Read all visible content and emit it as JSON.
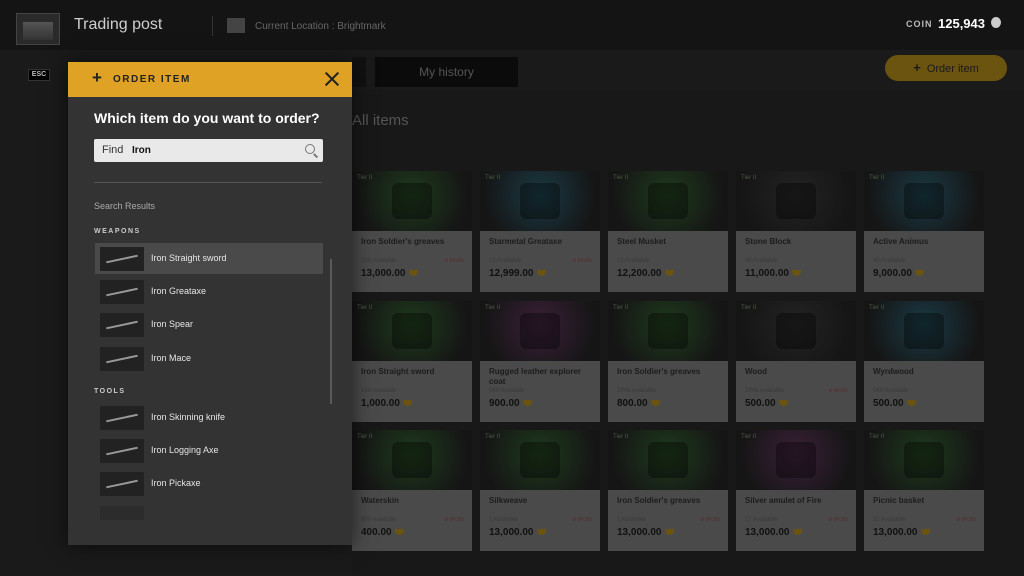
{
  "header": {
    "title": "Trading post",
    "location": "Current Location : Brightmark",
    "coin_label": "COIN",
    "coin_value": "125,943"
  },
  "esc_label": "ESC",
  "page": {
    "tab_history": "My history",
    "order_button": "Order item",
    "order_button_plus": "+",
    "section_title": "All items"
  },
  "cards": [
    {
      "tier": "Tier II",
      "name": "Iron Soldier's greaves",
      "available": "208 Available",
      "sale": "⊘ 84.5%",
      "price": "13,000.00",
      "color": "#1e3a1c"
    },
    {
      "tier": "Tier II",
      "name": "Starmetal Greataxe",
      "available": "12 Available",
      "sale": "⊘ 84.5%",
      "price": "12,999.00",
      "color": "#1a3a45"
    },
    {
      "tier": "Tier II",
      "name": "Steel Musket",
      "available": "12 Available",
      "sale": "",
      "price": "12,200.00",
      "color": "#1e3a1c"
    },
    {
      "tier": "Tier II",
      "name": "Stone Block",
      "available": "40 Available",
      "sale": "",
      "price": "11,000.00",
      "color": "#232323"
    },
    {
      "tier": "Tier II",
      "name": "Active Animus",
      "available": "45 Available",
      "sale": "",
      "price": "9,000.00",
      "color": "#1a3a45"
    },
    {
      "tier": "Tier II",
      "name": "Iron Straight sword",
      "available": "149 Available",
      "sale": "",
      "price": "1,000.00",
      "color": "#1e3a1c"
    },
    {
      "tier": "Tier II",
      "name": "Rugged leather explorer coat",
      "available": "549 Available",
      "sale": "",
      "price": "900.00",
      "color": "#3a2038"
    },
    {
      "tier": "Tier II",
      "name": "Iron Soldier's greaves",
      "available": "2049 Available",
      "sale": "",
      "price": "800.00",
      "color": "#1e3a1c"
    },
    {
      "tier": "Tier II",
      "name": "Wood",
      "available": "2049 Available",
      "sale": "⊘ 84.5%",
      "price": "500.00",
      "color": "#232323"
    },
    {
      "tier": "Tier II",
      "name": "Wyrdwood",
      "available": "549 Available",
      "sale": "",
      "price": "500.00",
      "color": "#1a3a45"
    },
    {
      "tier": "Tier II",
      "name": "Waterskin",
      "available": "999 Available",
      "sale": "⊘ 84.5%",
      "price": "400.00",
      "color": "#1e3a1c"
    },
    {
      "tier": "Tier II",
      "name": "Silkweave",
      "available": "1 Available",
      "sale": "⊘ 84.5%",
      "price": "13,000.00",
      "color": "#1e3a1c"
    },
    {
      "tier": "Tier II",
      "name": "Iron Soldier's greaves",
      "available": "1 Available",
      "sale": "⊘ 84.5%",
      "price": "13,000.00",
      "color": "#1e3a1c"
    },
    {
      "tier": "Tier II",
      "name": "Silver amulet of Fire",
      "available": "27 Available",
      "sale": "⊘ 84.5%",
      "price": "13,000.00",
      "color": "#3a2038"
    },
    {
      "tier": "Tier II",
      "name": "Picnic basket",
      "available": "32 Available",
      "sale": "⊘ 84.5%",
      "price": "13,000.00",
      "color": "#1e3a1c"
    }
  ],
  "modal": {
    "plus": "+",
    "title": "ORDER ITEM",
    "question": "Which item do you want to order?",
    "find_label": "Find",
    "find_value": "Iron",
    "results_label": "Search Results",
    "weapons_label": "WEAPONS",
    "tools_label": "TOOLS",
    "weapons": [
      "Iron Straight sword",
      "Iron Greataxe",
      "Iron Spear",
      "Iron Mace"
    ],
    "tools": [
      "Iron Skinning knife",
      "Iron Logging Axe",
      "Iron Pickaxe"
    ]
  }
}
